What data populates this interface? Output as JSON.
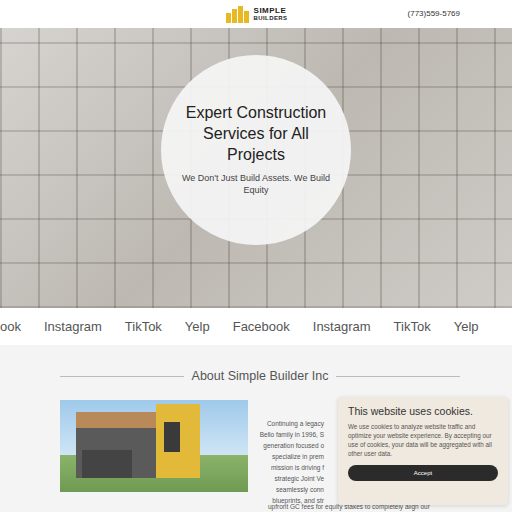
{
  "header": {
    "logo": {
      "line1": "SIMPLE",
      "line2": "BUILDERS"
    },
    "phone": "(773)559-5769"
  },
  "hero": {
    "title": "Expert Construction Services for All Projects",
    "tagline": "We Don't Just Build Assets. We Build Equity"
  },
  "social": [
    "ook",
    "Instagram",
    "TikTok",
    "Yelp",
    "Facebook",
    "Instagram",
    "TikTok",
    "Yelp"
  ],
  "about": {
    "heading": "About Simple Builder Inc",
    "lines": [
      "Continuing a legacy",
      "Bello family in 1996, S",
      "generation focused o",
      "specialize in prem",
      "mission is driving f",
      "strategic Joint Ve",
      "seamlessly conn",
      "blueprints, and str"
    ],
    "last_line": "upfront GC fees for equity stakes to completely align our"
  },
  "cookie": {
    "title": "This website uses cookies.",
    "text": "We use cookies to analyze website traffic and optimize your website experience. By accepting our use of cookies, your data will be aggregated with all other user data.",
    "button": "Accept"
  }
}
